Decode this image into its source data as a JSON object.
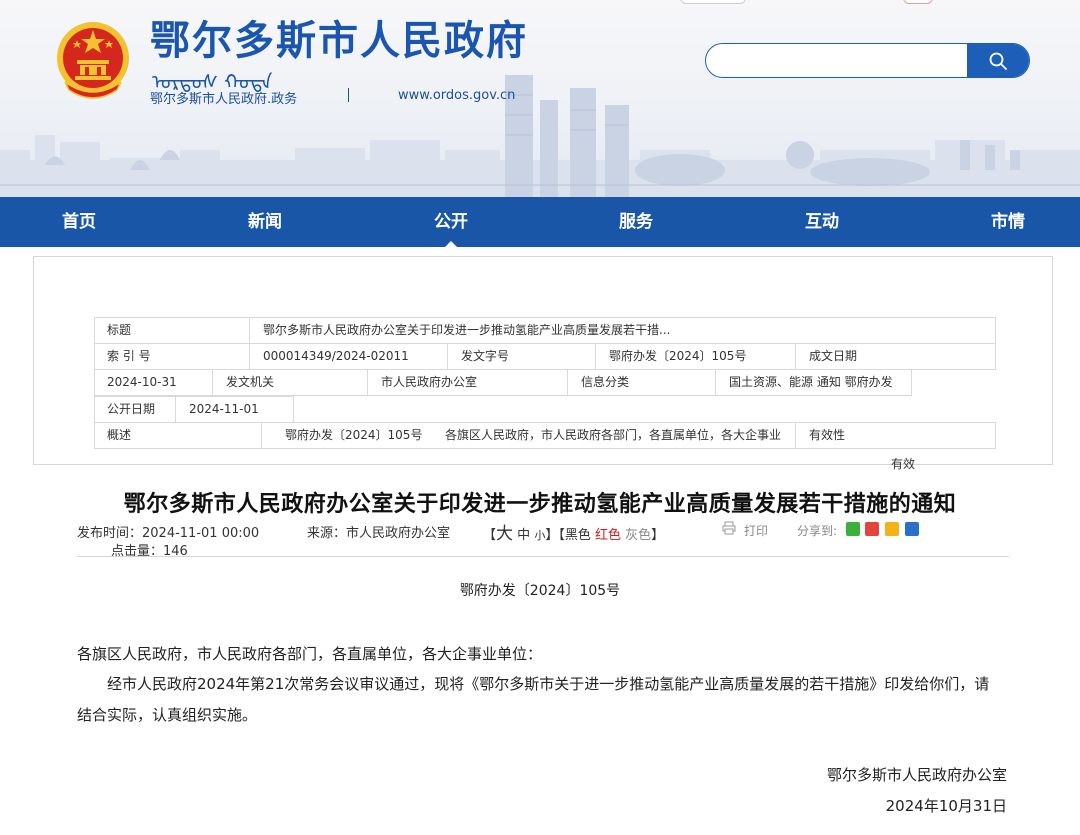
{
  "header": {
    "site_title": "鄂尔多斯市人民政府",
    "site_subtitle": "鄂尔多斯市人民政府.政务",
    "site_url": "www.ordos.gov.cn",
    "search_placeholder": ""
  },
  "nav": {
    "items": [
      {
        "label": "首页"
      },
      {
        "label": "新闻"
      },
      {
        "label": "公开"
      },
      {
        "label": "服务"
      },
      {
        "label": "互动"
      },
      {
        "label": "市情"
      }
    ],
    "active": "公开"
  },
  "meta": {
    "title_label": "标题",
    "title_value": "鄂尔多斯市人民政府办公室关于印发进一步推动氢能产业高质量发展若干措...",
    "index_label": "索 引 号",
    "index_value": "000014349/2024-02011",
    "docno_label": "发文字号",
    "docno_value": "鄂府办发〔2024〕105号",
    "date_label": "成文日期",
    "date_value": "2024-10-31",
    "issuer_label": "发文机关",
    "issuer_value": "市人民政府办公室",
    "category_label": "信息分类",
    "category_value": "国土资源、能源  通知  鄂府办发",
    "pubdate_label": "公开日期",
    "pubdate_value": "2024-11-01",
    "summary_label": "概述",
    "summary_docno": "鄂府办发〔2024〕105号",
    "summary_recipients": "各旗区人民政府，市人民政府各部门，各直属单位，各大企事业",
    "validity_label": "有效性",
    "validity_value": "有效"
  },
  "article": {
    "title": "鄂尔多斯市人民政府办公室关于印发进一步推动氢能产业高质量发展若干措施的通知",
    "publish_label": "发布时间：",
    "publish_time": "2024-11-01 00:00",
    "source_label": "来源：",
    "source": "市人民政府办公室",
    "size_open": "【",
    "size_large": "大",
    "size_medium": "中",
    "size_small": "小",
    "size_close": "】",
    "color_open": "【",
    "color_black": "黑色",
    "color_red": "红色",
    "color_gray": "灰色",
    "color_close": "】",
    "print_label": "打印",
    "share_label": "分享到:",
    "clicks_label": "点击量：",
    "clicks": "146",
    "doc_number": "鄂府办发〔2024〕105号",
    "salutation": "各旗区人民政府，市人民政府各部门，各直属单位，各大企事业单位：",
    "body_line1": "经市人民政府2024年第21次常务会议审议通过，现将《鄂尔多斯市关于进一步推动氢能产业高质量发展的若干措施》印发给你们，请",
    "body_line2": "结合实际，认真组织实施。",
    "signature": "鄂尔多斯市人民政府办公室",
    "sign_date": "2024年10月31日"
  },
  "colors": {
    "brand_blue": "#1a56a8",
    "title_blue": "#1a56b0",
    "emblem_red": "#d6271f",
    "emblem_gold": "#f2c230",
    "text_red": "#d21d1d"
  },
  "icons": {
    "search": "search-icon",
    "print": "printer-icon",
    "share_wechat": "wechat-icon",
    "share_weibo": "weibo-icon",
    "share_qzone": "qzone-icon",
    "share_renren": "renren-icon"
  }
}
